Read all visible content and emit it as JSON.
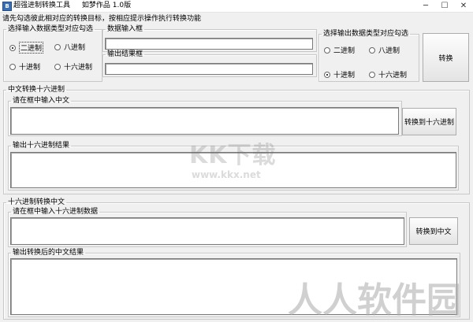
{
  "window": {
    "title": "超强进制转换工具",
    "author": "如梦作品 1.0版"
  },
  "hint": "请先勾选彼此相对应的转换目标，按相应提示操作执行转换功能",
  "input_type_group": {
    "legend": "选择输入数据类型对应勾选",
    "options": [
      "二进制",
      "八进制",
      "十进制",
      "十六进制"
    ],
    "selected": "二进制"
  },
  "data_input": {
    "label": "数据输入框",
    "value": ""
  },
  "output_result": {
    "label": "输出结果框",
    "value": ""
  },
  "output_type_group": {
    "legend": "选择输出数据类型对应勾选",
    "options": [
      "二进制",
      "八进制",
      "十进制",
      "十六进制"
    ],
    "selected": "十进制"
  },
  "convert_button": "转换",
  "cn_to_hex": {
    "legend": "中文转换十六进制",
    "input_label": "请在框中输入中文",
    "input_value": "",
    "button": "转换到十六进制",
    "output_label": "输出十六进制结果",
    "output_value": ""
  },
  "hex_to_cn": {
    "legend": "十六进制转换中文",
    "input_label": "请在框中输入十六进制数据",
    "input_value": "",
    "button": "转换到中文",
    "output_label": "输出转换后的中文结果",
    "output_value": ""
  },
  "watermarks": {
    "kkx_logo": "KK下载",
    "kkx_url": "www.kkx.net",
    "rrz": "人人软件园"
  }
}
